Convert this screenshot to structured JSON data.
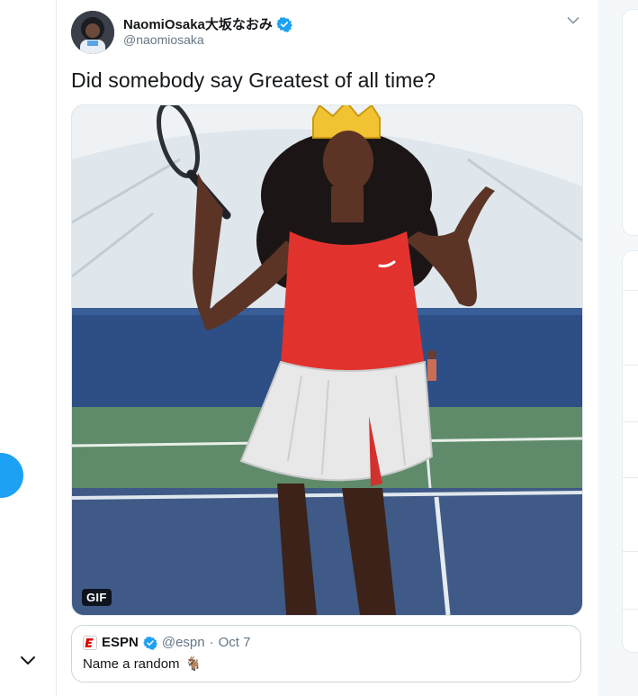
{
  "tweet": {
    "display_name": "NaomiOsaka大坂なおみ",
    "handle": "@naomiosaka",
    "text": "Did somebody say Greatest of all time?",
    "media": {
      "badge": "GIF"
    }
  },
  "quoted_tweet": {
    "name": "ESPN",
    "handle": "@espn",
    "separator": "·",
    "date": "Oct 7",
    "text": "Name a random",
    "emoji": "🐐"
  },
  "icons": {
    "verified": "verified-badge-icon",
    "caret": "chevron-down-icon",
    "espn": "espn-logo-icon",
    "sidebar_chevron": "chevron-down-icon"
  },
  "colors": {
    "accent": "#1da1f2",
    "text": "#14171a",
    "muted": "#657786",
    "border": "#e6ecf0"
  }
}
